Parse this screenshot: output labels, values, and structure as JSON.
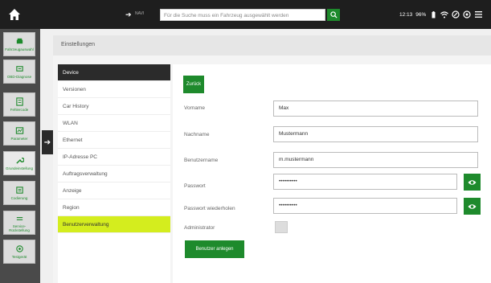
{
  "topbar": {
    "nav_label": "NAVI",
    "search_placeholder": "Für die Suche muss ein Fahrzeug ausgewählt werden",
    "time": "12:13",
    "battery": "96%"
  },
  "sidebar": {
    "items": [
      {
        "label": "Fahrzeugauswahl",
        "icon": "car-icon"
      },
      {
        "label": "OBD-Diagnose",
        "icon": "obd-icon"
      },
      {
        "label": "Fehlercode",
        "icon": "error-code-icon"
      },
      {
        "label": "Parameter",
        "icon": "parameter-icon"
      },
      {
        "label": "Grundeinstellung",
        "icon": "wrench-icon"
      },
      {
        "label": "Codierung",
        "icon": "coding-icon"
      },
      {
        "label": "Service-Rückstellung",
        "icon": "service-icon"
      },
      {
        "label": "Testgerät",
        "icon": "tester-icon"
      }
    ]
  },
  "header": {
    "title": "Einstellungen"
  },
  "menu": {
    "items": [
      "Device",
      "Versionen",
      "Car History",
      "WLAN",
      "Ethernet",
      "IP-Adresse PC",
      "Auftragsverwaltung",
      "Anzeige",
      "Region",
      "Benutzerverwaltung"
    ]
  },
  "form": {
    "back_label": "Zurück",
    "vorname_label": "Vorname",
    "vorname_value": "Max",
    "nachname_label": "Nachname",
    "nachname_value": "Mustermann",
    "benutzername_label": "Benutzername",
    "benutzername_value": "m.mustermann",
    "passwort_label": "Passwort",
    "passwort_value": "••••••••••",
    "passwort_wiederholen_label": "Passwort wiederholen",
    "passwort_wiederholen_value": "••••••••••",
    "administrator_label": "Administrator",
    "create_label": "Benutzer anlegen"
  },
  "colors": {
    "accent": "#1e8a2c",
    "highlight": "#d4ed1e",
    "dark": "#2b2b2b"
  }
}
